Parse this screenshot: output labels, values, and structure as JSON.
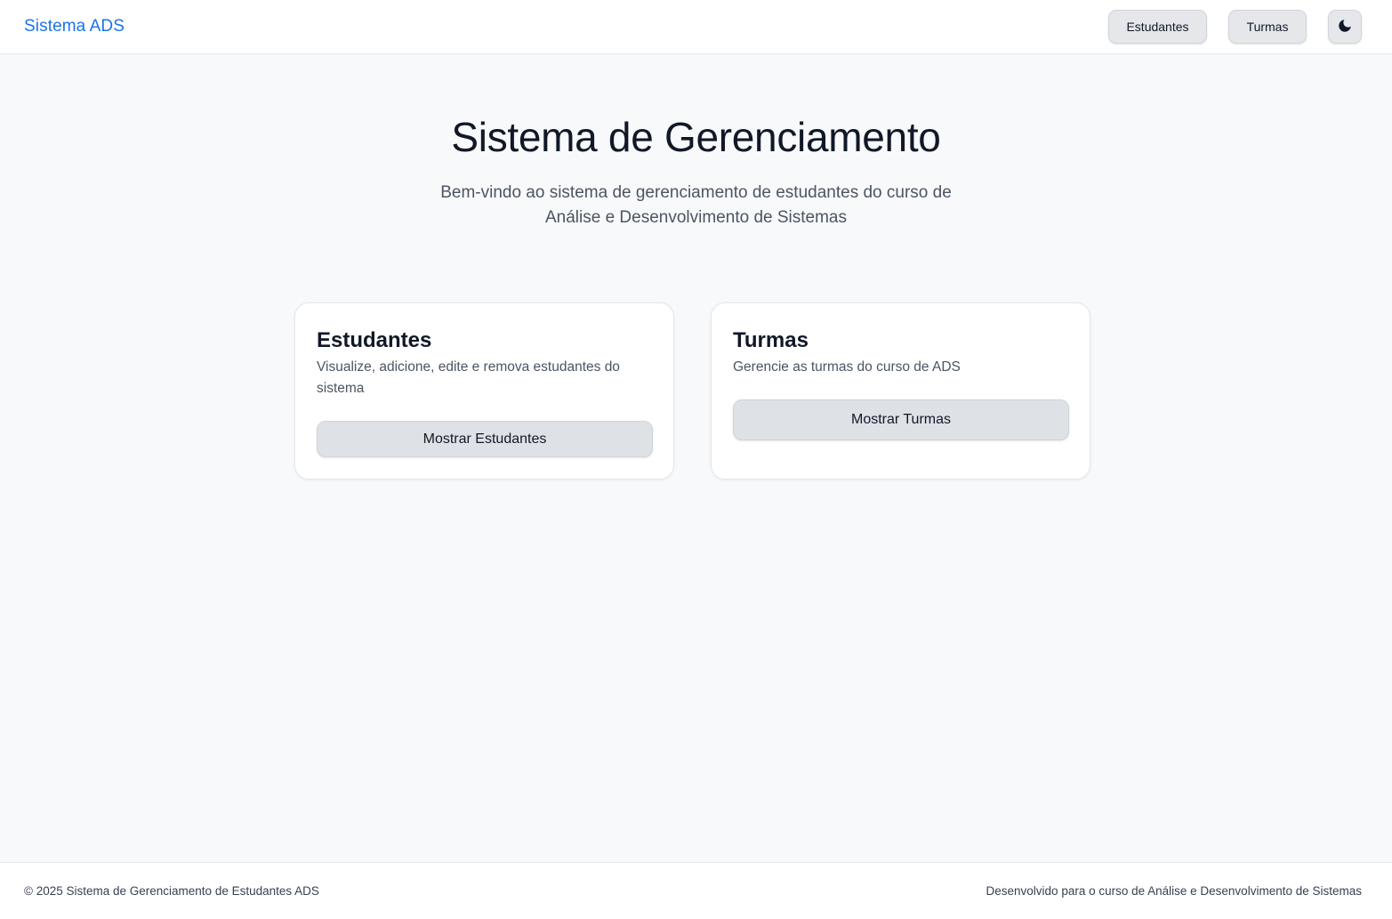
{
  "header": {
    "brand": "Sistema ADS",
    "nav": {
      "students_label": "Estudantes",
      "classes_label": "Turmas"
    },
    "theme_toggle_icon": "moon-icon"
  },
  "hero": {
    "title": "Sistema de Gerenciamento",
    "subtitle": "Bem-vindo ao sistema de gerenciamento de estudantes do curso de Análise e Desenvolvimento de Sistemas"
  },
  "cards": [
    {
      "title": "Estudantes",
      "description": "Visualize, adicione, edite e remova estudantes do sistema",
      "button_label": "Mostrar Estudantes"
    },
    {
      "title": "Turmas",
      "description": "Gerencie as turmas do curso de ADS",
      "button_label": "Mostrar Turmas"
    }
  ],
  "footer": {
    "copyright": "© 2025 Sistema de Gerenciamento de Estudantes ADS",
    "credit": "Desenvolvido para o curso de Análise e Desenvolvimento de Sistemas"
  },
  "colors": {
    "brand": "#1a73e8",
    "background": "#f8f9fa",
    "button": "#e5e7eb"
  }
}
